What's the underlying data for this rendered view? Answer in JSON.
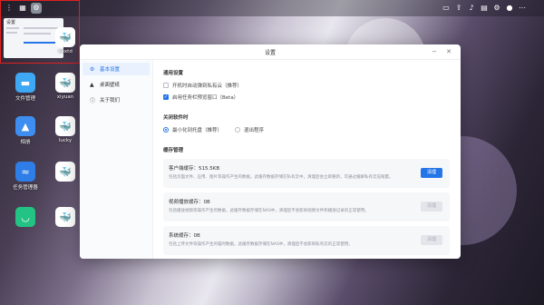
{
  "desktop": {
    "icons": [
      {
        "label": "文件管理",
        "glyph": "▬"
      },
      {
        "label": "xiyuan",
        "glyph": "🐳"
      },
      {
        "label": "相册",
        "glyph": "▲"
      },
      {
        "label": "lucky",
        "glyph": "🐳"
      },
      {
        "label": "任务管理器",
        "glyph": "≈"
      },
      {
        "label": "",
        "glyph": "🐳"
      },
      {
        "label": "",
        "glyph": "◡"
      },
      {
        "label": "",
        "glyph": "🐳"
      },
      {
        "label": "nextd",
        "glyph": "🐳"
      }
    ]
  },
  "preview": {
    "title": "设置"
  },
  "window": {
    "title": "设置",
    "sidebar": [
      {
        "label": "基本设置",
        "icon": "gear-icon",
        "glyph": "⚙",
        "active": true
      },
      {
        "label": "桌面壁纸",
        "icon": "image-icon",
        "glyph": "▲",
        "active": false
      },
      {
        "label": "关于我们",
        "icon": "info-icon",
        "glyph": "ⓘ",
        "active": false
      }
    ],
    "general": {
      "title": "通用设置",
      "options": [
        {
          "label": "开机时自动弹到私有云（推荐）",
          "checked": false
        },
        {
          "label": "启用任务栏预览窗口（Beta）",
          "checked": true
        }
      ]
    },
    "close": {
      "title": "关闭软件时",
      "options": [
        {
          "label": "最小化到托盘（推荐）",
          "selected": true
        },
        {
          "label": "退出程序",
          "selected": false
        }
      ]
    },
    "cache": {
      "title": "缓存管理",
      "items": [
        {
          "name": "客户端缓存：515.5KB",
          "desc": "包括页面文件、应用、图片等操作产生的数据，此缓存数据存储在私有云中，清理后会立即重新，可通过缓解私有云压缩量。",
          "button": "清理",
          "enabled": true
        },
        {
          "name": "视频播放缓存：0B",
          "desc": "包括播放视频等操作产生的数据，此缓存数据存储在NAS中，清理后不会影响视频文件和播放记录的正常使用。",
          "button": "清理",
          "enabled": false
        },
        {
          "name": "系统缓存：0B",
          "desc": "包括上传文件等操作产生的临时数据，此缓存数据存储在NAS中，清理后不会影响私有云的正常使用。",
          "button": "清理",
          "enabled": false
        }
      ]
    }
  },
  "colors": {
    "accent": "#2476e8",
    "preview_border": "#e02020"
  }
}
